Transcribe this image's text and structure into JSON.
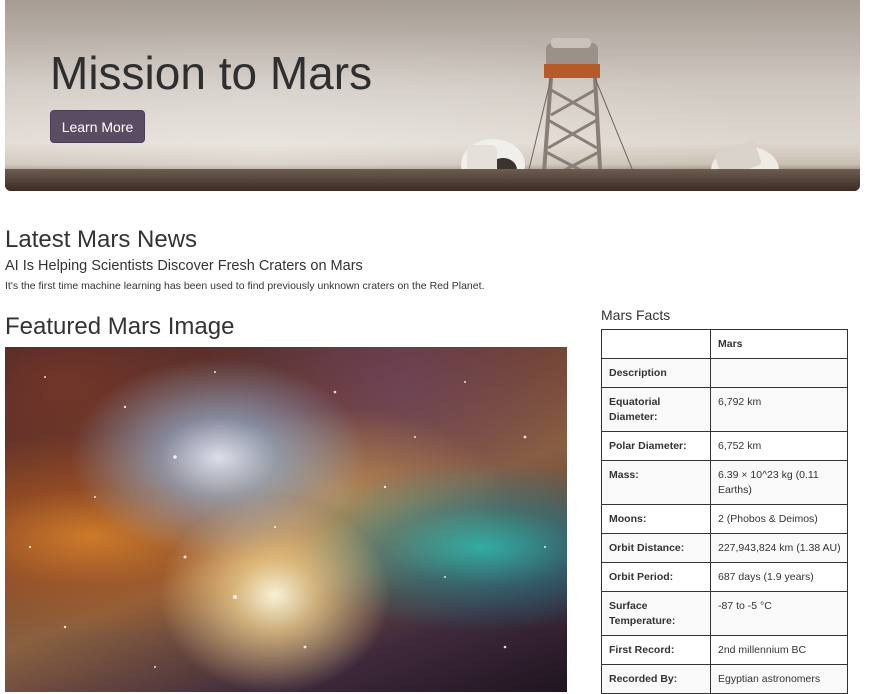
{
  "hero": {
    "title": "Mission to Mars",
    "button_label": "Learn More"
  },
  "news": {
    "heading": "Latest Mars News",
    "title": "AI Is Helping Scientists Discover Fresh Craters on Mars",
    "teaser": "It's the first time machine learning has been used to find previously unknown craters on the Red Planet."
  },
  "featured_image": {
    "heading": "Featured Mars Image",
    "alt": "nebula image"
  },
  "facts": {
    "heading": "Mars Facts",
    "column_header": "Mars",
    "rows": [
      {
        "label": "Description",
        "value": ""
      },
      {
        "label": "Equatorial Diameter:",
        "value": "6,792 km"
      },
      {
        "label": "Polar Diameter:",
        "value": "6,752 km"
      },
      {
        "label": "Mass:",
        "value": "6.39 × 10^23 kg (0.11 Earths)"
      },
      {
        "label": "Moons:",
        "value": "2 (Phobos & Deimos)"
      },
      {
        "label": "Orbit Distance:",
        "value": "227,943,824 km (1.38 AU)"
      },
      {
        "label": "Orbit Period:",
        "value": "687 days (1.9 years)"
      },
      {
        "label": "Surface Temperature:",
        "value": "-87 to -5 °C"
      },
      {
        "label": "First Record:",
        "value": "2nd millennium BC"
      },
      {
        "label": "Recorded By:",
        "value": "Egyptian astronomers"
      }
    ]
  }
}
